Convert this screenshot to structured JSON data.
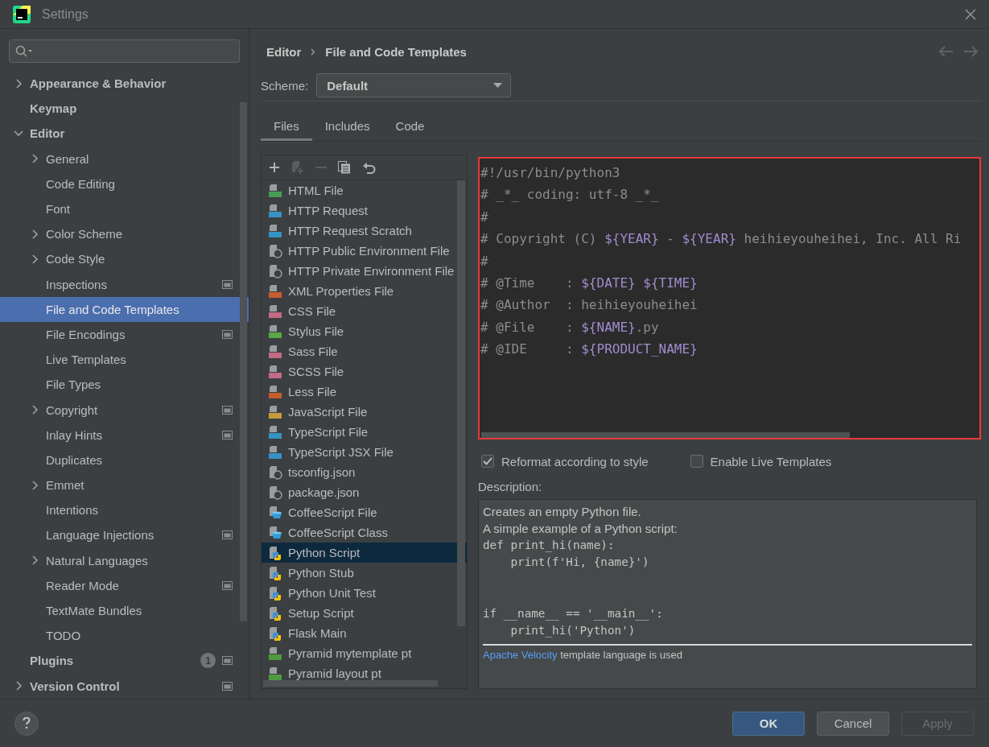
{
  "window": {
    "title": "Settings"
  },
  "sidebar": {
    "items": [
      {
        "label": "Appearance & Behavior",
        "selected": false,
        "expanded": false
      },
      {
        "label": "Keymap",
        "selected": false
      },
      {
        "label": "Editor",
        "selected": false,
        "expanded": true,
        "children": [
          {
            "label": "General",
            "selected": false,
            "expanded": false
          },
          {
            "label": "Code Editing",
            "selected": false
          },
          {
            "label": "Font",
            "selected": false
          },
          {
            "label": "Color Scheme",
            "selected": false,
            "expanded": false
          },
          {
            "label": "Code Style",
            "selected": false,
            "expanded": false
          },
          {
            "label": "Inspections",
            "selected": false,
            "scoped": true
          },
          {
            "label": "File and Code Templates",
            "selected": true
          },
          {
            "label": "File Encodings",
            "selected": false,
            "scoped": true
          },
          {
            "label": "Live Templates",
            "selected": false
          },
          {
            "label": "File Types",
            "selected": false
          },
          {
            "label": "Copyright",
            "selected": false,
            "expanded": false,
            "scoped": true
          },
          {
            "label": "Inlay Hints",
            "selected": false,
            "scoped": true
          },
          {
            "label": "Duplicates",
            "selected": false
          },
          {
            "label": "Emmet",
            "selected": false,
            "expanded": false
          },
          {
            "label": "Intentions",
            "selected": false
          },
          {
            "label": "Language Injections",
            "selected": false,
            "scoped": true
          },
          {
            "label": "Natural Languages",
            "selected": false,
            "expanded": false
          },
          {
            "label": "Reader Mode",
            "selected": false,
            "scoped": true
          },
          {
            "label": "TextMate Bundles",
            "selected": false
          },
          {
            "label": "TODO",
            "selected": false
          }
        ]
      },
      {
        "label": "Plugins",
        "selected": false,
        "badge": "1",
        "scoped": true
      },
      {
        "label": "Version Control",
        "selected": false,
        "expanded": false,
        "scoped": true
      }
    ]
  },
  "breadcrumb": [
    "Editor",
    "File and Code Templates"
  ],
  "scheme": {
    "label": "Scheme:",
    "value": "Default"
  },
  "tabs": [
    {
      "label": "Files",
      "selected": true
    },
    {
      "label": "Includes",
      "selected": false
    },
    {
      "label": "Code",
      "selected": false
    }
  ],
  "toolbar": [
    {
      "kind": "add",
      "disabled": false
    },
    {
      "kind": "add-child",
      "disabled": true
    },
    {
      "kind": "remove",
      "disabled": true
    },
    {
      "kind": "copy",
      "disabled": false
    },
    {
      "kind": "revert",
      "disabled": false
    }
  ],
  "templates": [
    {
      "label": "HTML File",
      "kind": "badge",
      "color": "#499c54",
      "selected": false
    },
    {
      "label": "HTTP Request",
      "kind": "badge",
      "color": "#3592c4",
      "selected": false
    },
    {
      "label": "HTTP Request Scratch",
      "kind": "badge",
      "color": "#3592c4",
      "selected": false
    },
    {
      "label": "HTTP Public Environment File",
      "kind": "json",
      "selected": false
    },
    {
      "label": "HTTP Private Environment File",
      "kind": "json",
      "selected": false
    },
    {
      "label": "XML Properties File",
      "kind": "badge",
      "color": "#c75c2e",
      "selected": false
    },
    {
      "label": "CSS File",
      "kind": "badge",
      "color": "#c36a84",
      "selected": false
    },
    {
      "label": "Stylus File",
      "kind": "badge",
      "color": "#59a842",
      "selected": false
    },
    {
      "label": "Sass File",
      "kind": "badge",
      "color": "#c36a84",
      "selected": false
    },
    {
      "label": "SCSS File",
      "kind": "badge",
      "color": "#c36a84",
      "selected": false
    },
    {
      "label": "Less File",
      "kind": "badge",
      "color": "#c55d2c",
      "selected": false
    },
    {
      "label": "JavaScript File",
      "kind": "badge",
      "color": "#c69a3c",
      "selected": false
    },
    {
      "label": "TypeScript File",
      "kind": "badge",
      "color": "#3592c4",
      "selected": false
    },
    {
      "label": "TypeScript JSX File",
      "kind": "badge",
      "color": "#3592c4",
      "selected": false
    },
    {
      "label": "tsconfig.json",
      "kind": "json",
      "selected": false
    },
    {
      "label": "package.json",
      "kind": "json",
      "selected": false
    },
    {
      "label": "CoffeeScript File",
      "kind": "coffee",
      "selected": false
    },
    {
      "label": "CoffeeScript Class",
      "kind": "coffee",
      "selected": false
    },
    {
      "label": "Python Script",
      "kind": "python",
      "selected": true
    },
    {
      "label": "Python Stub",
      "kind": "python",
      "selected": false
    },
    {
      "label": "Python Unit Test",
      "kind": "python",
      "selected": false
    },
    {
      "label": "Setup Script",
      "kind": "python",
      "selected": false
    },
    {
      "label": "Flask Main",
      "kind": "python",
      "selected": false
    },
    {
      "label": "Pyramid mytemplate pt",
      "kind": "badge",
      "color": "#4e9a3e",
      "selected": false
    },
    {
      "label": "Pyramid layout pt",
      "kind": "badge",
      "color": "#4e9a3e",
      "selected": false
    }
  ],
  "editor": {
    "highlighted": true,
    "lines": [
      [
        {
          "text": "#!/usr/bin/python3",
          "kind": "comment"
        }
      ],
      [
        {
          "text": "# _*_ coding: utf-8 _*_",
          "kind": "comment"
        }
      ],
      [
        {
          "text": "#",
          "kind": "comment"
        }
      ],
      [
        {
          "text": "# Copyright (C) ",
          "kind": "comment"
        },
        {
          "text": "${YEAR}",
          "kind": "variable"
        },
        {
          "text": " - ",
          "kind": "comment"
        },
        {
          "text": "${YEAR}",
          "kind": "variable"
        },
        {
          "text": " heihieyouheihei, Inc. All Ri",
          "kind": "comment"
        }
      ],
      [
        {
          "text": "#",
          "kind": "comment"
        }
      ],
      [
        {
          "text": "# @Time    : ",
          "kind": "comment"
        },
        {
          "text": "${DATE} ${TIME}",
          "kind": "variable"
        }
      ],
      [
        {
          "text": "# @Author  : heihieyouheihei",
          "kind": "comment"
        }
      ],
      [
        {
          "text": "# @File    : ",
          "kind": "comment"
        },
        {
          "text": "${NAME}",
          "kind": "variable"
        },
        {
          "text": ".py",
          "kind": "comment"
        }
      ],
      [
        {
          "text": "# @IDE     : ",
          "kind": "comment"
        },
        {
          "text": "${PRODUCT_NAME}",
          "kind": "variable"
        }
      ]
    ]
  },
  "options": [
    {
      "label": "Reformat according to style",
      "checked": true
    },
    {
      "label": "Enable Live Templates",
      "checked": false
    }
  ],
  "description": {
    "label": "Description:",
    "text": [
      "Creates an empty Python file.",
      "A simple example of a Python script:"
    ],
    "code": "def print_hi(name):\n    print(f'Hi, {name}')\n\n\nif __name__ == '__main__':\n    print_hi('Python')",
    "footer": {
      "link": "Apache Velocity",
      "text": " template language is used"
    }
  },
  "buttons": [
    {
      "label": "OK",
      "kind": "primary",
      "disabled": false
    },
    {
      "label": "Cancel",
      "kind": "normal",
      "disabled": false
    },
    {
      "label": "Apply",
      "kind": "normal",
      "disabled": true
    }
  ]
}
